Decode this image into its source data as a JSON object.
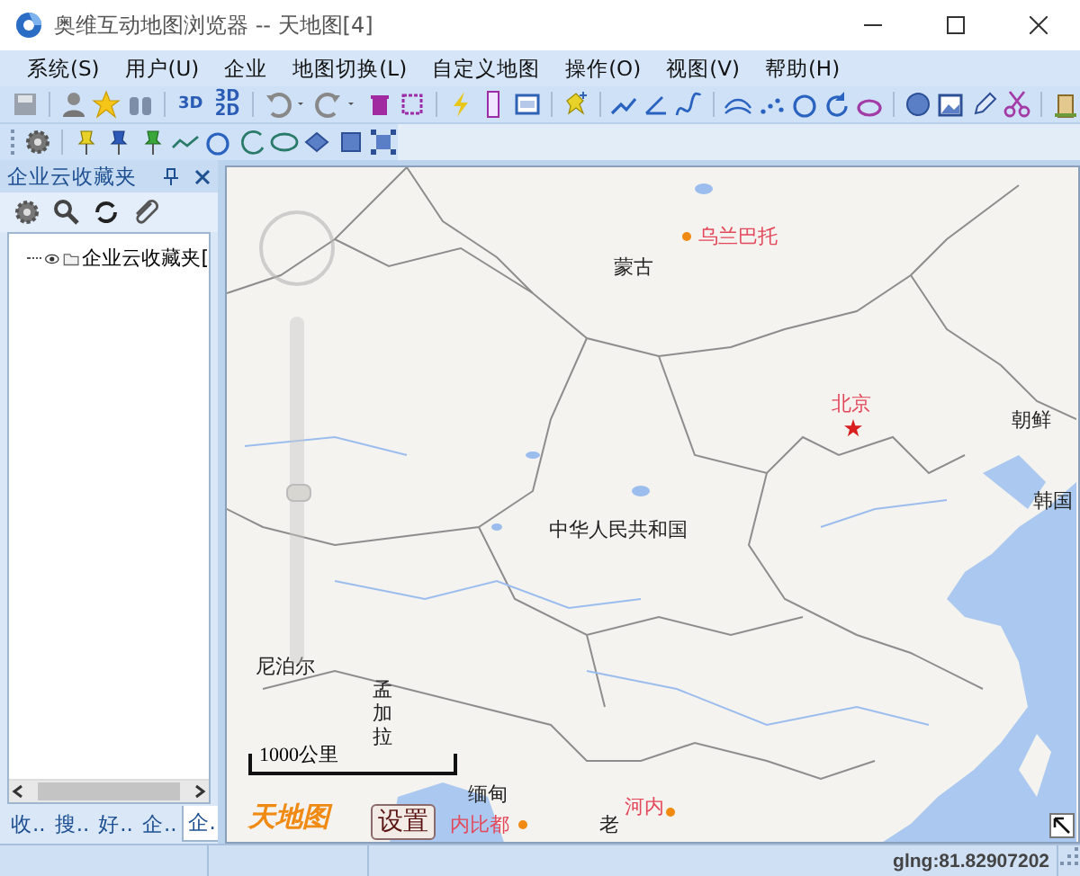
{
  "window": {
    "title": "奥维互动地图浏览器 -- 天地图[4]"
  },
  "menu": [
    "系统(S)",
    "用户(U)",
    "企业",
    "地图切换(L)",
    "自定义地图",
    "操作(O)",
    "视图(V)",
    "帮助(H)"
  ],
  "toolbar": {
    "text_buttons": [
      "3D",
      "3D 2D"
    ]
  },
  "panel": {
    "title": "企业云收藏夹",
    "tree": [
      {
        "label": "企业云收藏夹["
      }
    ],
    "tabs": [
      {
        "label": "收..",
        "selected": false
      },
      {
        "label": "搜..",
        "selected": false
      },
      {
        "label": "好..",
        "selected": false
      },
      {
        "label": "企..",
        "selected": false
      },
      {
        "label": "企.",
        "selected": true
      }
    ]
  },
  "map": {
    "labels": [
      {
        "kind": "country",
        "text": "蒙古"
      },
      {
        "kind": "city",
        "text": "乌兰巴托"
      },
      {
        "kind": "capital",
        "text": "北京"
      },
      {
        "kind": "country",
        "text": "朝鲜"
      },
      {
        "kind": "country",
        "text": "韩国"
      },
      {
        "kind": "country",
        "text": "中华人民共和国"
      },
      {
        "kind": "country",
        "text": "尼泊尔"
      },
      {
        "kind": "vertical",
        "text": "孟加拉"
      },
      {
        "kind": "country",
        "text": "缅甸"
      },
      {
        "kind": "city",
        "text": "内比都"
      },
      {
        "kind": "country",
        "text": "老"
      },
      {
        "kind": "city",
        "text": "河内"
      }
    ],
    "zoom": {
      "level": 0.5
    },
    "scale": "1000公里",
    "logo": "天地图",
    "settings_button": "设置"
  },
  "status_bar": {
    "coordinates": "glng:81.82907202"
  }
}
